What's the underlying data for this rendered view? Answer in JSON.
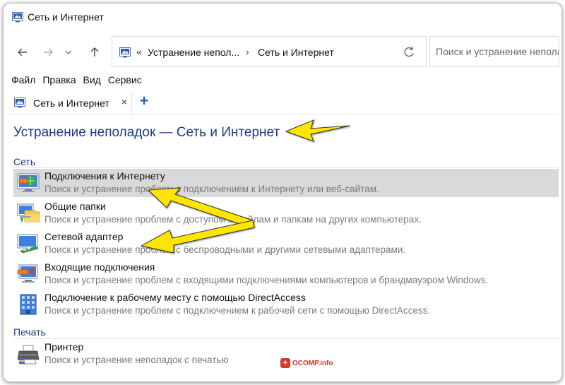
{
  "window": {
    "title": "Сеть и Интернет",
    "icon": "control-panel-icon"
  },
  "nav": {
    "back_icon": "arrow-left-icon",
    "forward_icon": "arrow-right-icon",
    "recent_icon": "chevron-down-icon",
    "up_icon": "arrow-up-icon"
  },
  "address": {
    "overflow": "«",
    "segments": [
      "Устранение непол...",
      "Сеть и Интернет"
    ],
    "refresh_icon": "refresh-icon"
  },
  "search": {
    "placeholder": "Поиск и устранение неполадок"
  },
  "menu": {
    "items": [
      "Файл",
      "Правка",
      "Вид",
      "Сервис"
    ]
  },
  "tab": {
    "label": "Сеть и Интернет",
    "close": "×",
    "add": "+"
  },
  "page": {
    "title": "Устранение неполадок — Сеть и Интернет"
  },
  "sections": [
    {
      "heading": "Сеть",
      "items": [
        {
          "title": "Подключения к Интернету",
          "desc": "Поиск и устранение проблем с подключением к Интернету или веб-сайтам.",
          "icon": "internet-connection-icon",
          "highlighted": true
        },
        {
          "title": "Общие папки",
          "desc": "Поиск и устранение проблем с доступом к файлам и папкам на других компьютерах.",
          "icon": "shared-folders-icon",
          "highlighted": false
        },
        {
          "title": "Сетевой адаптер",
          "desc": "Поиск и устранение проблем с беспроводными и другими сетевыми адаптерами.",
          "icon": "network-adapter-icon",
          "highlighted": false
        },
        {
          "title": "Входящие подключения",
          "desc": "Поиск и устранение проблем с входящими подключениями компьютеров и брандмауэром Windows.",
          "icon": "incoming-connections-icon",
          "highlighted": false
        },
        {
          "title": "Подключение к рабочему месту с помощью DirectAccess",
          "desc": "Поиск и устранение проблем с подключением к рабочей сети с помощью DirectAccess.",
          "icon": "directaccess-icon",
          "highlighted": false
        }
      ]
    },
    {
      "heading": "Печать",
      "items": [
        {
          "title": "Принтер",
          "desc": "Поиск и устранение неполадок с печатью",
          "icon": "printer-icon",
          "highlighted": false
        }
      ]
    }
  ],
  "watermark": {
    "text": "OCOMP.info"
  },
  "colors": {
    "heading_blue": "#1e3a8a",
    "highlight": "#d9d9d9",
    "arrow_yellow": "#ffe600",
    "add_tab_blue": "#1e5bd8"
  }
}
